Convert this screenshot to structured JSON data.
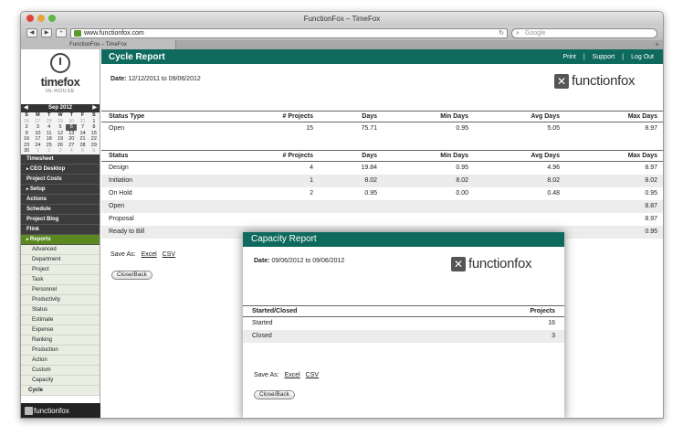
{
  "browser": {
    "window_title": "FunctionFox – TimeFox",
    "url": "www.functionfox.com",
    "search_placeholder": "Google",
    "tab_title": "FunctionFox – TimeFox"
  },
  "sidebar": {
    "logo_text": "timefox",
    "logo_sub": "IN-HOUSE",
    "calendar": {
      "month": "Sep 2012",
      "weekdays": [
        "S",
        "M",
        "T",
        "W",
        "T",
        "F",
        "S"
      ],
      "days": [
        "26",
        "27",
        "28",
        "29",
        "30",
        "31",
        "1",
        "2",
        "3",
        "4",
        "5",
        "6",
        "7",
        "8",
        "9",
        "10",
        "11",
        "12",
        "13",
        "14",
        "15",
        "16",
        "17",
        "18",
        "19",
        "20",
        "21",
        "22",
        "23",
        "24",
        "25",
        "26",
        "27",
        "28",
        "29",
        "30",
        "1",
        "2",
        "3",
        "4",
        "5",
        "6"
      ]
    },
    "menu": [
      "Timesheet",
      "CEO Desktop",
      "Project Costs",
      "Setup",
      "Actions",
      "Schedule",
      "Project Blog",
      "Flink"
    ],
    "reports_label": "Reports",
    "reports_sub": [
      "Advanced",
      "Department",
      "Project",
      "Task",
      "Personnel",
      "Productivity",
      "Status",
      "Estimate",
      "Expense",
      "Ranking",
      "Production",
      "Action",
      "Custom",
      "Capacity",
      "Cycle"
    ],
    "footer_brand": "functionfox"
  },
  "main": {
    "title": "Cycle Report",
    "links": [
      "Print",
      "Support",
      "Log Out"
    ],
    "separator": "|",
    "date_label": "Date:",
    "date_value": "12/12/2011 to 09/06/2012",
    "brand": "functionfox",
    "table1": {
      "headers": [
        "Status Type",
        "# Projects",
        "Days",
        "Min Days",
        "Avg Days",
        "Max Days"
      ],
      "rows": [
        [
          "Open",
          "15",
          "75.71",
          "0.95",
          "5.05",
          "8.97"
        ]
      ]
    },
    "table2": {
      "headers": [
        "Status",
        "# Projects",
        "Days",
        "Min Days",
        "Avg Days",
        "Max Days"
      ],
      "rows": [
        [
          "Design",
          "4",
          "19.84",
          "0.95",
          "4.96",
          "8.97"
        ],
        [
          "Initiation",
          "1",
          "8.02",
          "8.02",
          "8.02",
          "8.02"
        ],
        [
          "On Hold",
          "2",
          "0.95",
          "0.00",
          "0.48",
          "0.95"
        ],
        [
          "Open",
          "",
          "",
          "",
          "",
          "8.87"
        ],
        [
          "Proposal",
          "",
          "",
          "",
          "",
          "8.97"
        ],
        [
          "Ready to Bill",
          "",
          "",
          "",
          "",
          "0.95"
        ]
      ]
    },
    "save_as_label": "Save As:",
    "excel": "Excel",
    "csv": "CSV",
    "close_back": "Close/Back"
  },
  "capacity": {
    "title": "Capacity Report",
    "date_label": "Date:",
    "date_value": "09/06/2012 to 09/06/2012",
    "brand": "functionfox",
    "headers": [
      "Started/Closed",
      "Projects"
    ],
    "rows": [
      [
        "Started",
        "16"
      ],
      [
        "Closed",
        "3"
      ]
    ],
    "save_as_label": "Save As:",
    "excel": "Excel",
    "csv": "CSV",
    "close_back": "Close/Back"
  }
}
